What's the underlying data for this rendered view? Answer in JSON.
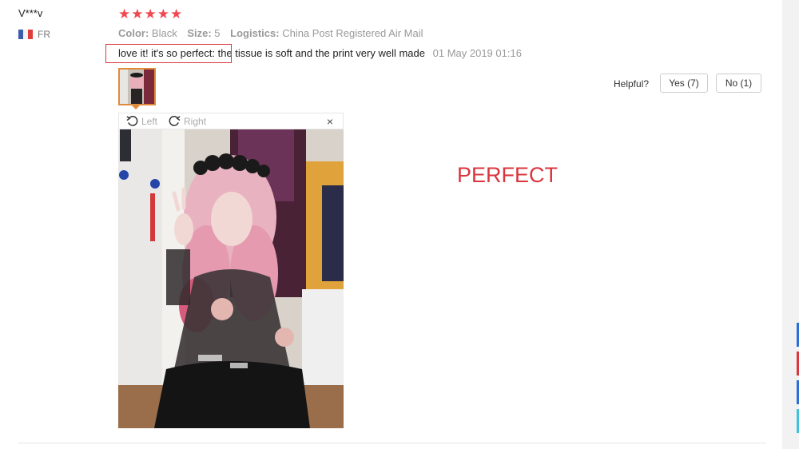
{
  "review": {
    "username": "V***v",
    "country": "FR",
    "rating": 5,
    "stars": [
      "★",
      "★",
      "★",
      "★",
      "★"
    ],
    "color_label": "Color:",
    "color_value": "Black",
    "size_label": "Size:",
    "size_value": "5",
    "logistics_label": "Logistics:",
    "logistics_value": "China Post Registered Air Mail",
    "text": "love it! it's so perfect: the tissue is soft and the print very well made",
    "date": "01 May 2019 01:16"
  },
  "viewer": {
    "rotate_left_label": "Left",
    "rotate_right_label": "Right",
    "close_glyph": "×"
  },
  "helpful": {
    "label": "Helpful?",
    "yes_label": "Yes (7)",
    "no_label": "No (1)"
  },
  "overlay_text": "PERFECT",
  "colors": {
    "star": "#f0484f",
    "highlight": "#d9383e",
    "thumb_border": "#e08a3c",
    "overlay_text": "#d9363e"
  },
  "icons": {
    "rotate_left": "rotate-left-icon",
    "rotate_right": "rotate-right-icon",
    "close": "close-icon",
    "flag": "flag-fr-icon"
  }
}
